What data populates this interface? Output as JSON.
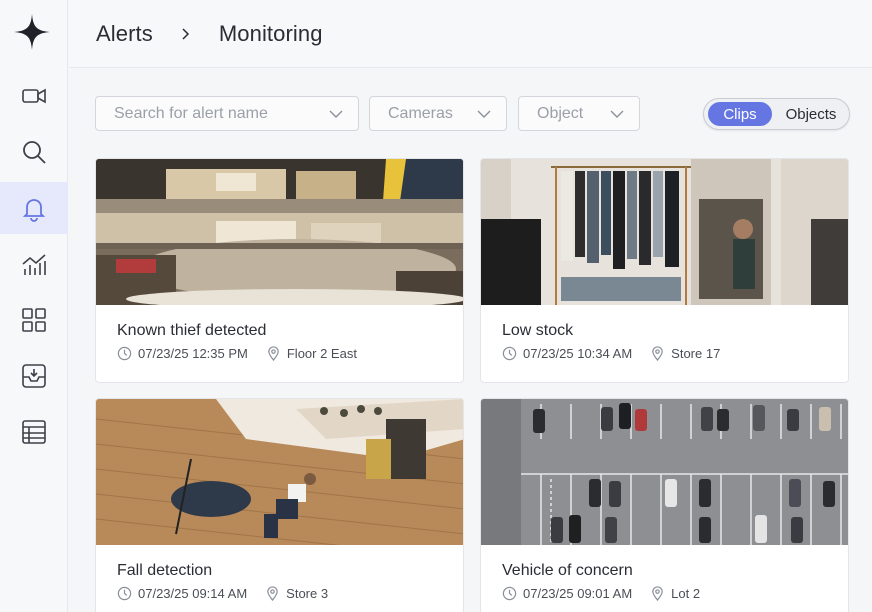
{
  "breadcrumb": {
    "parent": "Alerts",
    "current": "Monitoring"
  },
  "filters": {
    "search_placeholder": "Search for alert name",
    "cameras": "Cameras",
    "object": "Object"
  },
  "view_toggle": {
    "clips": "Clips",
    "objects": "Objects",
    "selected": "Clips"
  },
  "sidebar": {
    "items": [
      {
        "icon": "video-camera-icon"
      },
      {
        "icon": "search-icon"
      },
      {
        "icon": "bell-icon",
        "active": true
      },
      {
        "icon": "analytics-chart-icon"
      },
      {
        "icon": "grid-icon"
      },
      {
        "icon": "archive-download-icon"
      },
      {
        "icon": "table-icon"
      }
    ]
  },
  "alerts": [
    {
      "title": "Known thief detected",
      "time": "07/23/25 12:35 PM",
      "location": "Floor 2 East",
      "scene": "shopping-mall-atrium"
    },
    {
      "title": "Low stock",
      "time": "07/23/25 10:34 AM",
      "location": "Store 17",
      "scene": "clothing-rack"
    },
    {
      "title": "Fall detection",
      "time": "07/23/25 09:14 AM",
      "location": "Store 3",
      "scene": "store-floor-fallen-person"
    },
    {
      "title": "Vehicle of concern",
      "time": "07/23/25 09:01 AM",
      "location": "Lot 2",
      "scene": "parking-lot-aerial"
    }
  ],
  "colors": {
    "accent": "#6576e3",
    "active_nav_bg": "#e6e9fb"
  }
}
